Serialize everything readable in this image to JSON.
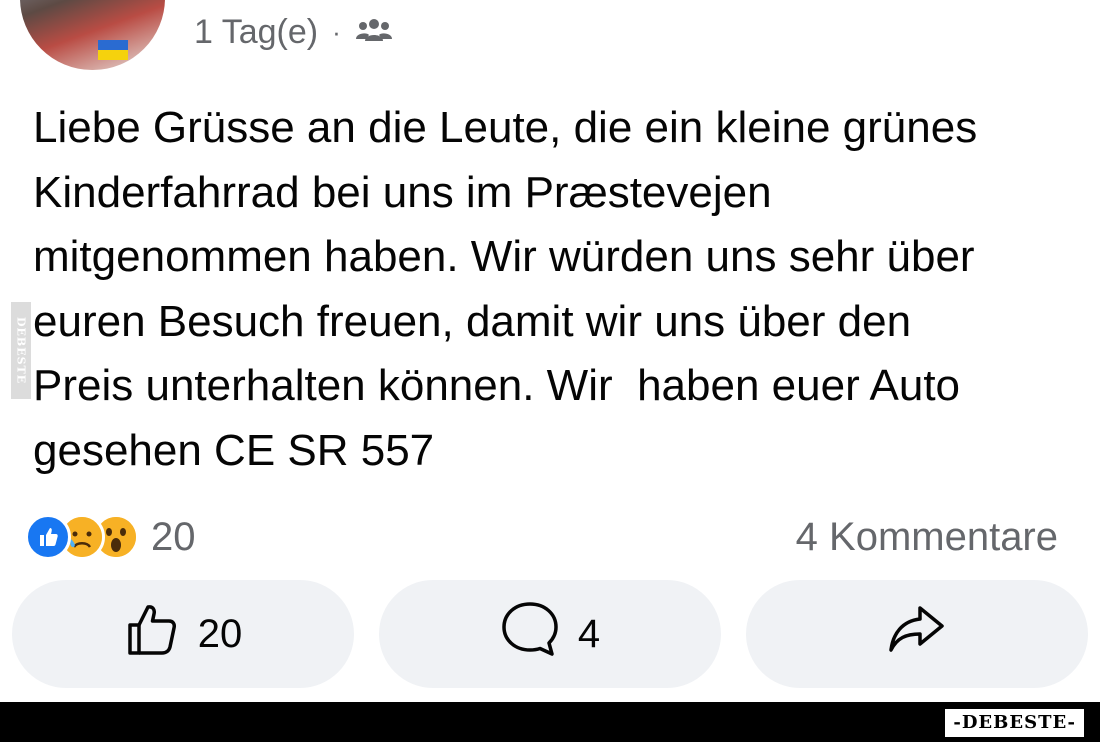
{
  "post": {
    "timestamp": "1 Tag(e)",
    "separator": "·",
    "audience_icon": "friends-icon",
    "text": "Liebe Grüsse an die Leute, die ein kleine grünes\nKinderfahrrad bei uns im Præstevejen\nmitgenommen haben. Wir würden uns sehr über\neuren Besuch freuen, damit wir uns über den\nPreis unterhalten können. Wir  haben euer Auto\ngesehen CE SR 557"
  },
  "reactions": {
    "icons": [
      "like-reaction-icon",
      "sad-reaction-icon",
      "wow-reaction-icon"
    ],
    "count": "20",
    "comments_label": "4 Kommentare"
  },
  "actions": {
    "like_count": "20",
    "comment_count": "4"
  },
  "watermark": {
    "side_text": "DEBESTE",
    "footer_text": "-DEBESTE-"
  },
  "colors": {
    "like_blue": "#1877f2",
    "emoji_yellow": "#f7b125",
    "button_bg": "#f0f2f5",
    "secondary_text": "#65676b"
  }
}
